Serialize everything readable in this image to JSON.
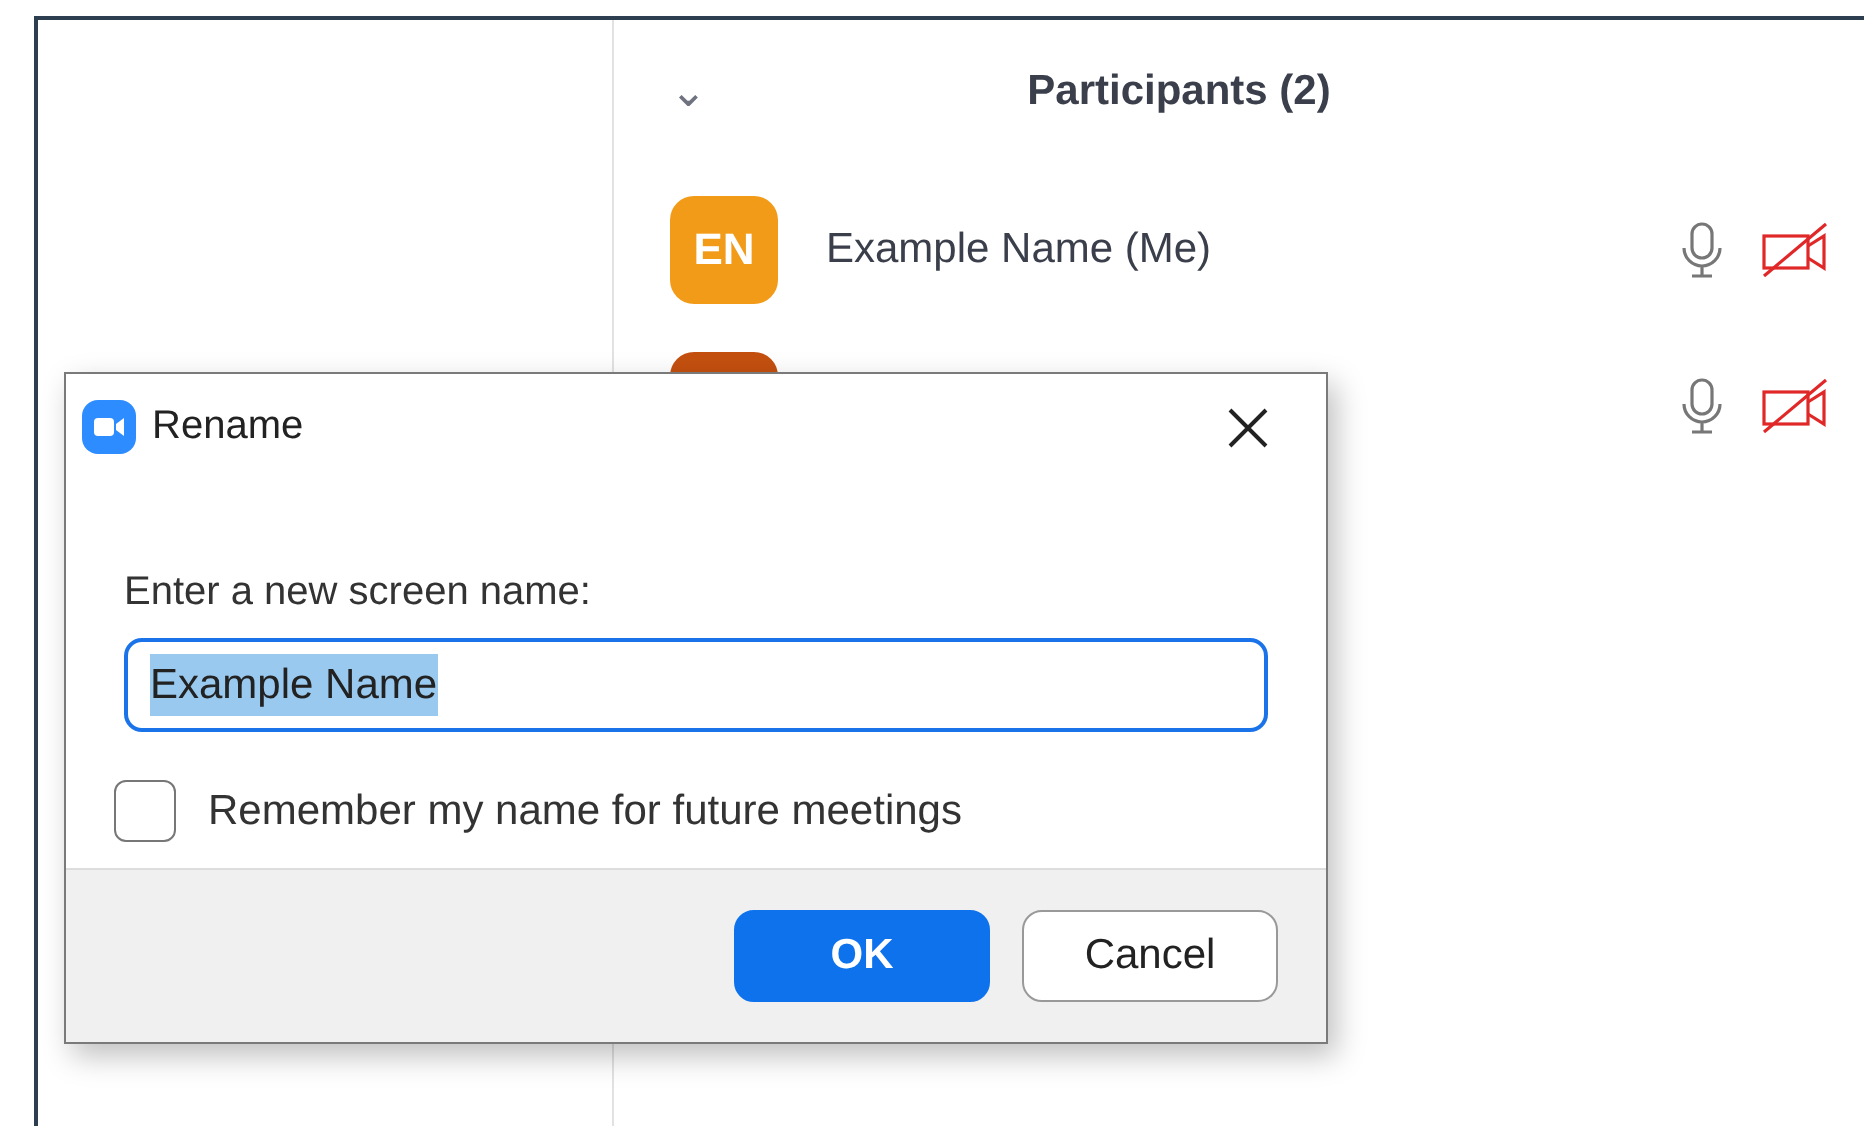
{
  "panel": {
    "title": "Participants (2)",
    "collapse_icon": "⌄"
  },
  "participants": [
    {
      "initials": "EN",
      "name": "Example Name (Me)",
      "color": "#f29b18",
      "mic_muted": false,
      "video_on": false
    },
    {
      "color": "#c4500f",
      "mic_muted": false,
      "video_on": false
    }
  ],
  "dialog": {
    "title": "Rename",
    "label": "Enter a new screen name:",
    "value": "Example Name",
    "value_selected": true,
    "checkbox": {
      "label": "Remember my name for future meetings",
      "checked": false
    },
    "buttons": [
      {
        "label": "OK",
        "kind": "primary"
      },
      {
        "label": "Cancel",
        "kind": "secondary"
      }
    ]
  }
}
